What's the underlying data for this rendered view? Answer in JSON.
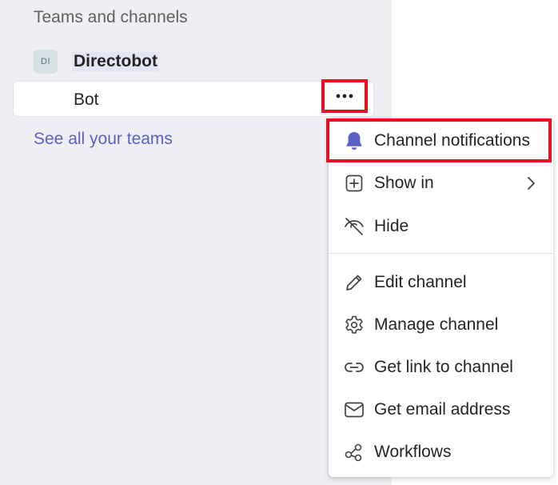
{
  "sidebar": {
    "section_title": "Teams and channels",
    "team": {
      "avatar_initials": "DI",
      "name": "Directobot"
    },
    "channel": {
      "name": "Bot",
      "more_icon": "more-horizontal-icon"
    },
    "see_all": "See all your teams"
  },
  "context_menu": {
    "items": [
      {
        "label": "Channel notifications",
        "icon": "bell-icon"
      },
      {
        "label": "Show in",
        "icon": "add-square-icon",
        "has_submenu": true
      },
      {
        "label": "Hide",
        "icon": "eye-off-icon"
      },
      {
        "label": "Edit channel",
        "icon": "pencil-icon"
      },
      {
        "label": "Manage channel",
        "icon": "gear-icon"
      },
      {
        "label": "Get link to channel",
        "icon": "link-icon"
      },
      {
        "label": "Get email address",
        "icon": "mail-icon"
      },
      {
        "label": "Workflows",
        "icon": "workflows-icon"
      }
    ]
  },
  "colors": {
    "accent": "#5b5fc7",
    "highlight_border": "#e81123"
  }
}
